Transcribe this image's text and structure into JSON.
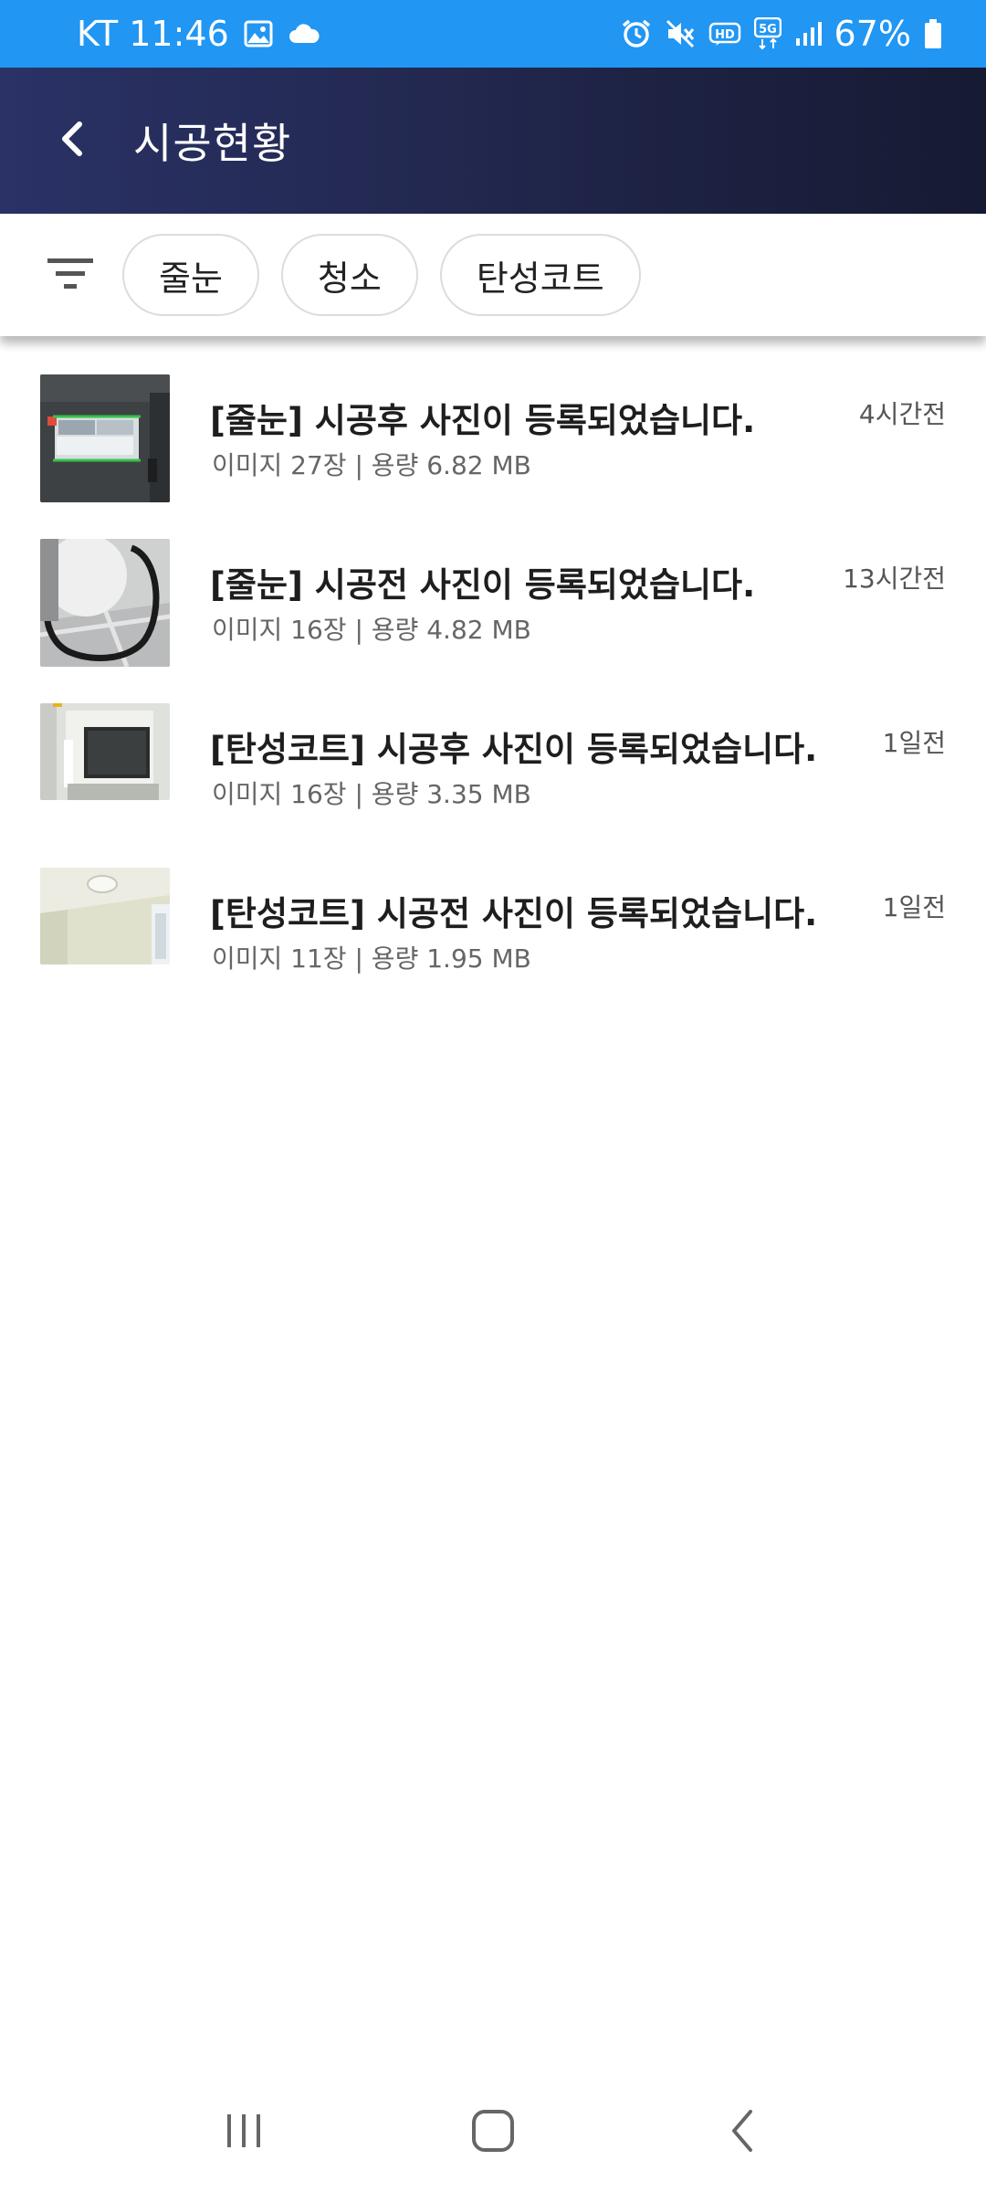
{
  "status_bar": {
    "carrier_time": "KT 11:46",
    "battery": "67%",
    "icons": [
      "gallery-icon",
      "cloud-icon",
      "alarm-icon",
      "mute-icon",
      "hd-icon",
      "5g-icon",
      "signal-icon",
      "battery-icon"
    ]
  },
  "app_bar": {
    "title": "시공현황",
    "background": "#232a55"
  },
  "filter": {
    "chips": [
      "줄눈",
      "청소",
      "탄성코트"
    ]
  },
  "items": [
    {
      "title": "[줄눈] 시공후 사진이 등록되었습니다.",
      "subtitle": "이미지 27장 | 용량 6.82 MB",
      "time": "4시간전"
    },
    {
      "title": "[줄눈] 시공전 사진이 등록되었습니다.",
      "subtitle": "이미지 16장 | 용량 4.82 MB",
      "time": "13시간전"
    },
    {
      "title": "[탄성코트] 시공후 사진이 등록되었습니다.",
      "subtitle": "이미지 16장 | 용량 3.35 MB",
      "time": "1일전"
    },
    {
      "title": "[탄성코트] 시공전 사진이 등록되었습니다.",
      "subtitle": "이미지 11장 | 용량 1.95 MB",
      "time": "1일전"
    }
  ],
  "colors": {
    "status_bar": "#2196f3",
    "title_text": "#1e1e1e",
    "sub_text": "#666666"
  }
}
